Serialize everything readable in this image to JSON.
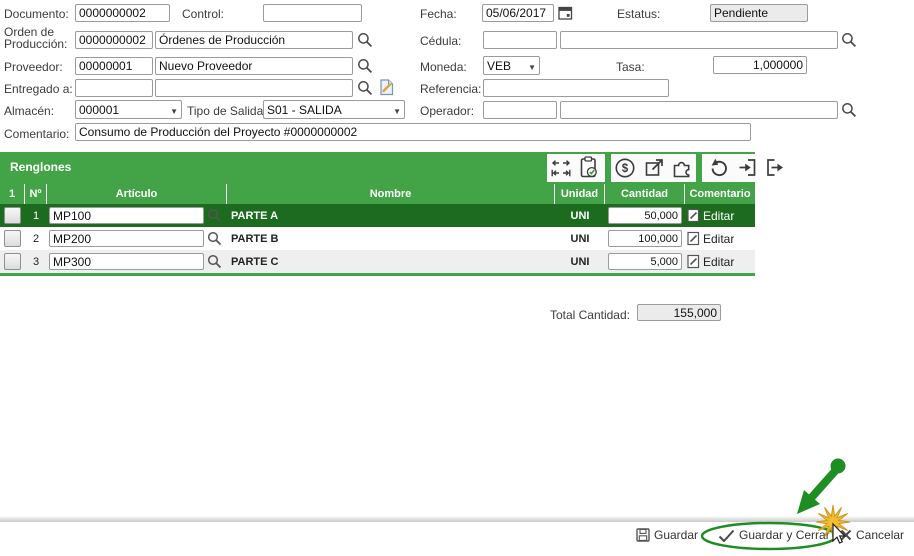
{
  "form": {
    "documento": {
      "label": "Documento:",
      "value": "0000000002"
    },
    "control": {
      "label": "Control:",
      "value": ""
    },
    "fecha": {
      "label": "Fecha:",
      "value": "05/06/2017"
    },
    "estatus": {
      "label": "Estatus:",
      "value": "Pendiente"
    },
    "orden": {
      "label": "Orden de Producción:",
      "code": "0000000002",
      "name": "Órdenes de Producción"
    },
    "cedula": {
      "label": "Cédula:",
      "code": "",
      "name": ""
    },
    "proveedor": {
      "label": "Proveedor:",
      "code": "00000001",
      "name": "Nuevo Proveedor"
    },
    "moneda": {
      "label": "Moneda:",
      "value": "VEB"
    },
    "tasa": {
      "label": "Tasa:",
      "value": "1,000000"
    },
    "entregado": {
      "label": "Entregado a:",
      "code": "",
      "name": ""
    },
    "referencia": {
      "label": "Referencia:",
      "value": ""
    },
    "almacen": {
      "label": "Almacén:",
      "value": "000001"
    },
    "tipo_salida": {
      "label": "Tipo de Salida:",
      "value": "S01 - SALIDA"
    },
    "operador": {
      "label": "Operador:",
      "code": "",
      "name": ""
    },
    "comentario": {
      "label": "Comentario:",
      "value": "Consumo de Producción del Proyecto #0000000002"
    }
  },
  "renglones": {
    "title": "Renglones",
    "toolbar_icons": [
      "nav-arrows",
      "clipboard-check",
      "currency",
      "open-window",
      "plugin",
      "refresh",
      "import",
      "export"
    ],
    "columns": [
      "1",
      "Nº",
      "Artículo",
      "Nombre",
      "Unidad",
      "Cantidad",
      "Comentario"
    ],
    "rows": [
      {
        "n": "1",
        "articulo": "MP100",
        "nombre": "PARTE A",
        "unidad": "UNI",
        "cantidad": "50,000",
        "editar": "Editar"
      },
      {
        "n": "2",
        "articulo": "MP200",
        "nombre": "PARTE B",
        "unidad": "UNI",
        "cantidad": "100,000",
        "editar": "Editar"
      },
      {
        "n": "3",
        "articulo": "MP300",
        "nombre": "PARTE C",
        "unidad": "UNI",
        "cantidad": "5,000",
        "editar": "Editar"
      }
    ],
    "total": {
      "label": "Total Cantidad:",
      "value": "155,000"
    }
  },
  "footer": {
    "guardar": "Guardar",
    "guardar_cerrar": "Guardar y Cerrar",
    "cancelar": "Cancelar"
  },
  "colors": {
    "green": "#42a446",
    "selected_row": "#1d6b1f",
    "annotation": "#1e8e22",
    "starburst": "#f2bc33"
  }
}
